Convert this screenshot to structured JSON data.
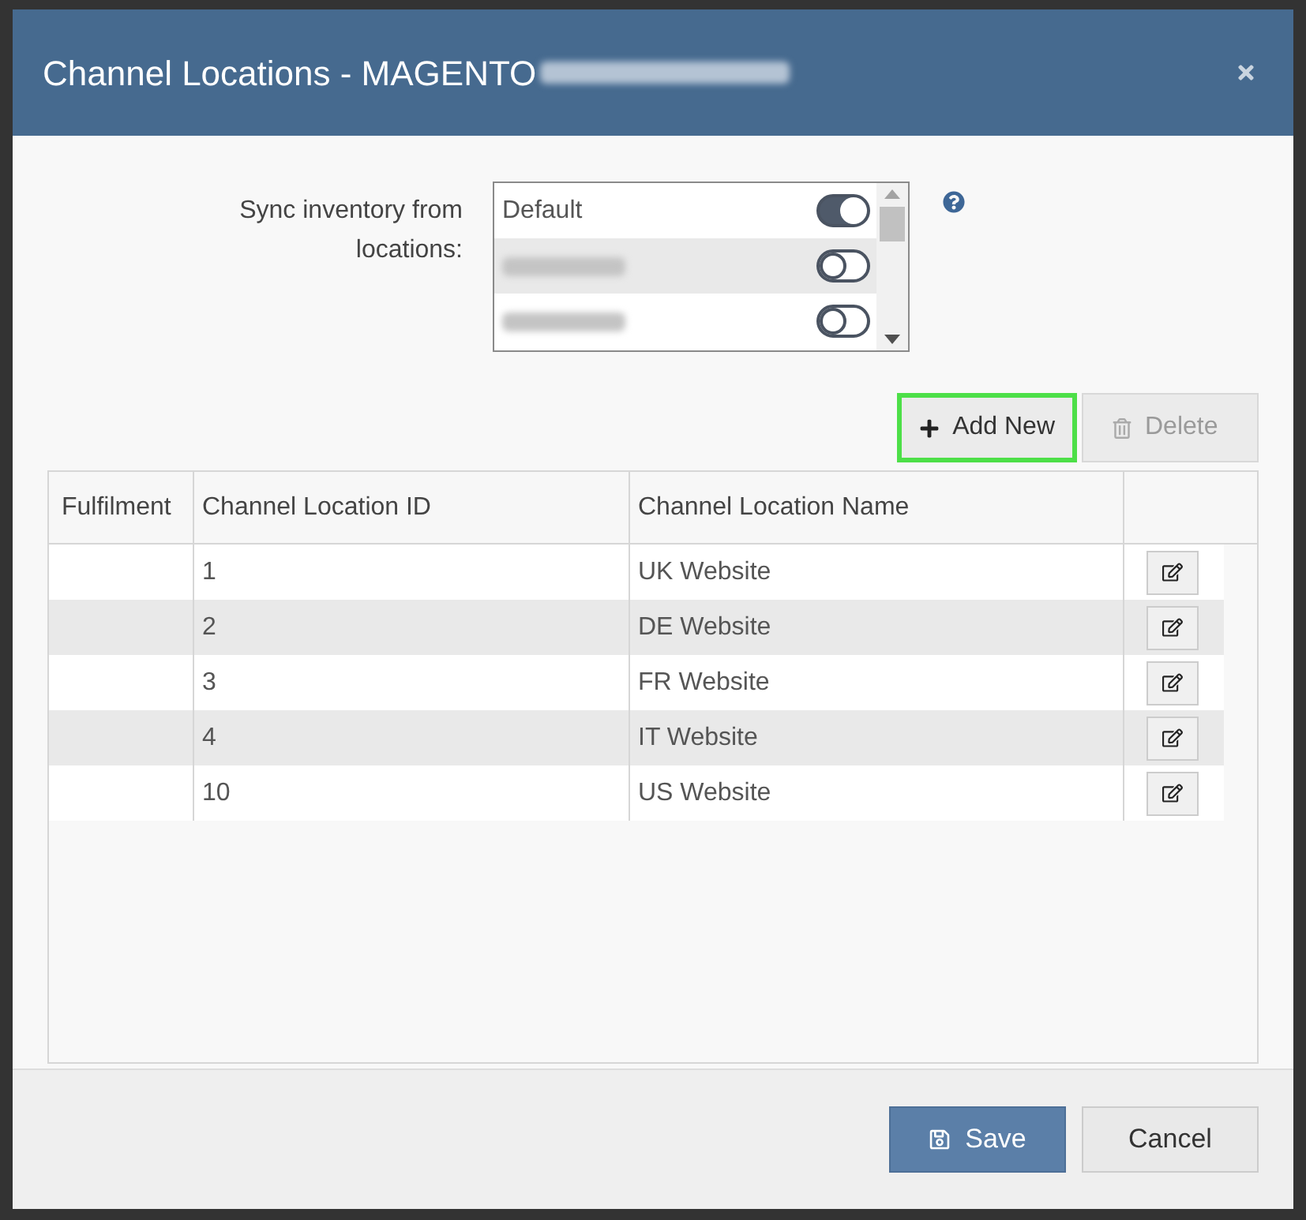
{
  "dialog": {
    "title": "Channel Locations - MAGENTO",
    "title_blurred": true
  },
  "sync": {
    "label": "Sync inventory from locations:",
    "locations": [
      {
        "kind": "text",
        "name": "Default",
        "on": true
      },
      {
        "kind": "blurred",
        "on": false
      },
      {
        "kind": "blurred",
        "on": false
      }
    ]
  },
  "toolbar": {
    "buttons": [
      {
        "kind": "add",
        "label": "Add New",
        "disabled": false,
        "highlighted": true
      },
      {
        "kind": "delete",
        "label": "Delete",
        "disabled": true,
        "highlighted": false
      }
    ]
  },
  "table": {
    "columns": [
      "Fulfilment",
      "Channel Location ID",
      "Channel Location Name"
    ],
    "rows": [
      {
        "id": "1",
        "name": "UK Website"
      },
      {
        "id": "2",
        "name": "DE Website"
      },
      {
        "id": "3",
        "name": "FR Website"
      },
      {
        "id": "4",
        "name": "IT Website"
      },
      {
        "id": "10",
        "name": "US Website"
      }
    ]
  },
  "footer": {
    "buttons": [
      {
        "kind": "save",
        "label": "Save"
      },
      {
        "kind": "cancel",
        "label": "Cancel"
      }
    ]
  }
}
